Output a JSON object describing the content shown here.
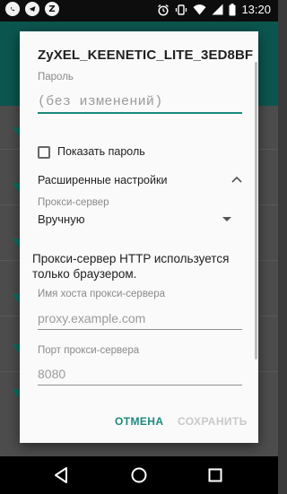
{
  "status_bar": {
    "time": "13:20",
    "icons": [
      "whatsapp-icon",
      "telegram-icon",
      "zen-icon",
      "alarm-icon",
      "vibrate-icon",
      "wifi-icon",
      "signal-icon",
      "battery-icon"
    ],
    "zen_letter": "Z"
  },
  "dialog": {
    "title": "ZyXEL_KEENETIC_LITE_3ED8BF",
    "password": {
      "label": "Пароль",
      "placeholder": "(без изменений)"
    },
    "show_password": {
      "label": "Показать пароль",
      "checked": false
    },
    "advanced": {
      "label": "Расширенные настройки",
      "expanded": true
    },
    "proxy": {
      "label": "Прокси-сервер",
      "value": "Вручную"
    },
    "info_text": "Прокси-сервер HTTP используется только браузером.",
    "host": {
      "label": "Имя хоста прокси-сервера",
      "placeholder": "proxy.example.com"
    },
    "port": {
      "label": "Порт прокси-сервера",
      "value": "8080"
    },
    "buttons": {
      "cancel": "ОТМЕНА",
      "save": "СОХРАНИТЬ"
    }
  },
  "colors": {
    "accent": "#1b8a7d",
    "disabled": "#c9c9c9",
    "app_header": "#0c5650"
  },
  "nav_bar": {
    "icons": [
      "back-icon",
      "home-icon",
      "recents-icon"
    ]
  }
}
